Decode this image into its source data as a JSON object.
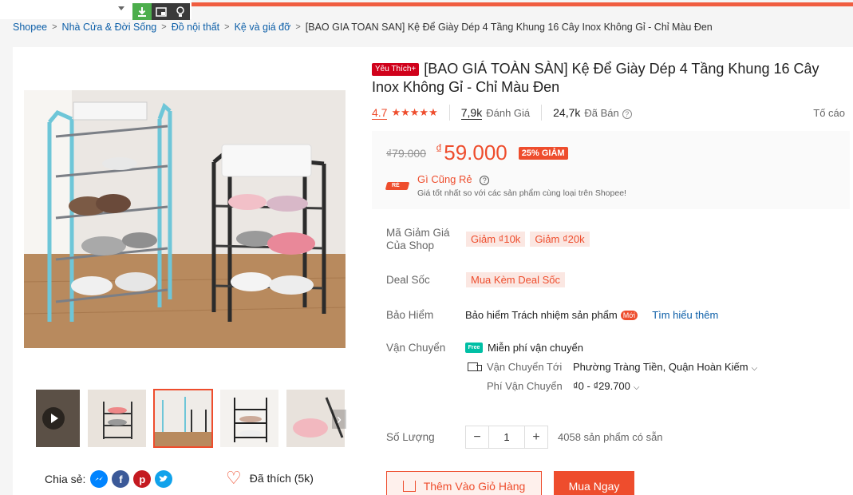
{
  "breadcrumb": {
    "items": [
      "Shopee",
      "Nhà Cửa & Đời Sống",
      "Đồ nội thất",
      "Kệ và giá đỡ"
    ],
    "current": "[BAO GIA TOAN SAN] Kệ Để Giày Dép 4 Tầng Khung 16 Cây Inox Không Gỉ - Chỉ Màu Đen"
  },
  "product": {
    "badge": "Yêu Thích+",
    "title": "[BAO GIÁ TOÀN SÀN] Kệ Để Giày Dép 4 Tầng Khung 16 Cây Inox Không Gỉ - Chỉ Màu Đen",
    "rating": "4.7",
    "stars": "★★★★★",
    "reviews_count": "7,9k",
    "reviews_label": "Đánh Giá",
    "sold_count": "24,7k",
    "sold_label": "Đã Bán",
    "report_label": "Tố cáo"
  },
  "price": {
    "original": "₫79.000",
    "currency": "₫",
    "current": "59.000",
    "discount": "25% GIẢM",
    "cheap_title": "Gì Cũng Rẻ",
    "cheap_desc": "Giá tốt nhất so với các sản phẩm cùng loại trên Shopee!",
    "cheap_logo_text": "RẺ"
  },
  "vouchers": {
    "label": "Mã Giảm Giá Của Shop",
    "items": [
      "Giảm ₫10k",
      "Giảm ₫20k"
    ]
  },
  "deal": {
    "label": "Deal Sốc",
    "item": "Mua Kèm Deal Sốc"
  },
  "insurance": {
    "label": "Bảo Hiểm",
    "text": "Bảo hiểm Trách nhiệm sản phẩm",
    "new_badge": "Mới",
    "learn_more": "Tìm hiểu thêm"
  },
  "shipping": {
    "label": "Vận Chuyển",
    "free_icon": "Free",
    "free_text": "Miễn phí vận chuyển",
    "to_label": "Vận Chuyển Tới",
    "to_value": "Phường Tràng Tiền, Quận Hoàn Kiếm",
    "fee_label": "Phí Vận Chuyển",
    "fee_value": "₫0 - ₫29.700"
  },
  "quantity": {
    "label": "Số Lượng",
    "value": "1",
    "stock": "4058 sản phẩm có sẵn"
  },
  "actions": {
    "add_to_cart": "Thêm Vào Giỏ Hàng",
    "buy_now": "Mua Ngay"
  },
  "share": {
    "label": "Chia sẻ:",
    "like_text": "Đã thích (5k)"
  },
  "icons": [
    "download-icon",
    "picture-in-picture-icon",
    "lightbulb-icon",
    "chevron-right-icon",
    "help-icon",
    "messenger-icon",
    "facebook-icon",
    "pinterest-icon",
    "twitter-icon",
    "heart-icon",
    "truck-icon",
    "cart-icon",
    "play-icon"
  ],
  "colors": {
    "accent": "#ee4d2d",
    "link": "#0d5fa8",
    "free_ship": "#00bfa5"
  }
}
